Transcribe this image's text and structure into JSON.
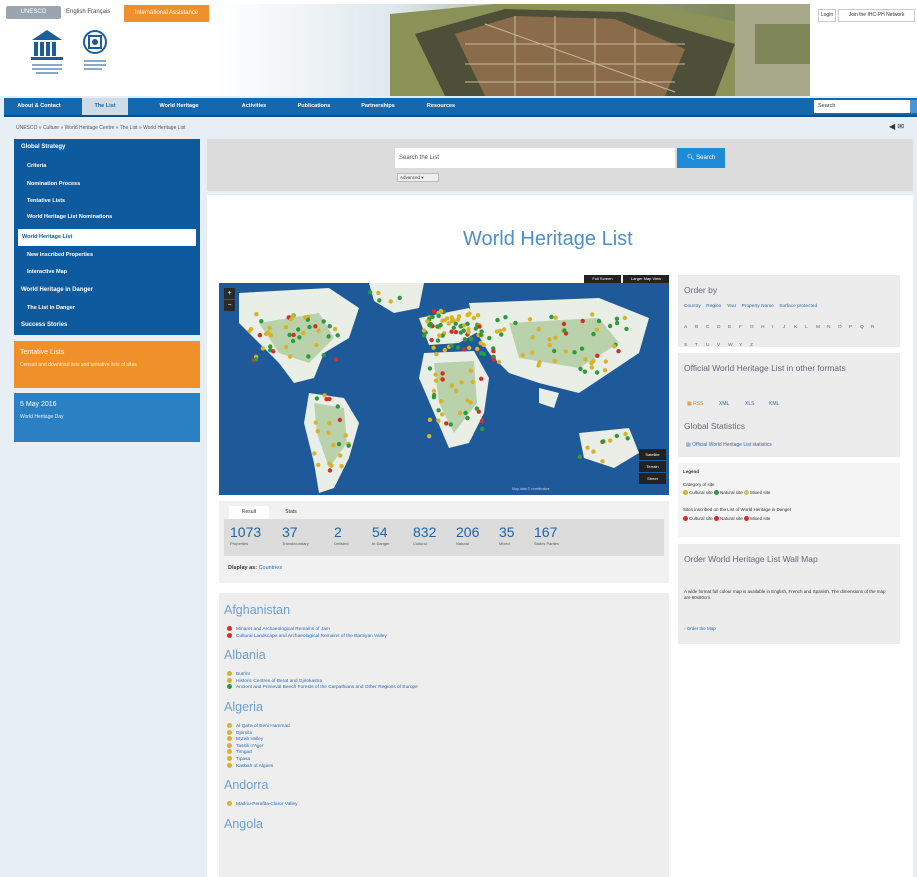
{
  "top": {
    "lang_pill": "UNESCO",
    "lang_links": "English Français",
    "orange_button": "International Assistance",
    "login": "Login",
    "join": "Join the IHC-PH Network"
  },
  "nav": {
    "items": [
      "About & Contact",
      "The List",
      "World Heritage",
      "Activities",
      "Publications",
      "Partnerships",
      "Resources"
    ],
    "search_value": "Search"
  },
  "breadcrumb": "UNESCO » Culture » World Heritage Centre » The List » World Heritage List",
  "sidebar": {
    "items": [
      "Global Strategy",
      "Criteria",
      "Nomination Process",
      "Tentative Lists",
      "World Heritage List Nominations",
      "World Heritage List",
      "New Inscribed Properties",
      "Interactive Map",
      "World Heritage in Danger",
      "The List in Danger",
      "Success Stories"
    ]
  },
  "promos": {
    "orange_title": "Tentative Lists",
    "orange_sub": "Consult and download lists and tentative lists of sites",
    "blue_title": "5 May 2016",
    "blue_sub": "World Heritage Day"
  },
  "search": {
    "placeholder": "Search the List",
    "button": "Search",
    "advanced": "Advanced"
  },
  "page_title": "World Heritage List",
  "map": {
    "btn_full": "Full Screen",
    "btn_large": "Larger Map View",
    "zoom_in": "+",
    "zoom_out": "−",
    "controls": [
      "Satellite",
      "Terrain",
      "Street"
    ],
    "attribution": "Map data © contributors"
  },
  "stats": {
    "tabs": [
      "Result",
      "Stats"
    ],
    "items": [
      {
        "num": "1073",
        "label": "Properties"
      },
      {
        "num": "37",
        "label": "Transboundary"
      },
      {
        "num": "2",
        "label": "Delisted"
      },
      {
        "num": "54",
        "label": "In Danger"
      },
      {
        "num": "832",
        "label": "Cultural"
      },
      {
        "num": "206",
        "label": "Natural"
      },
      {
        "num": "35",
        "label": "Mixed"
      },
      {
        "num": "167",
        "label": "States Parties"
      }
    ],
    "display": "Display as:",
    "display_value": "Countries"
  },
  "countries": [
    {
      "name": "Afghanistan",
      "sites": [
        {
          "t": "Minaret and Archaeological Remains of Jam",
          "c": "#d0322a"
        },
        {
          "t": "Cultural Landscape and Archaeological Remains of the Bamiyan Valley",
          "c": "#d0322a"
        }
      ]
    },
    {
      "name": "Albania",
      "sites": [
        {
          "t": "Butrint",
          "c": "#d7b22c"
        },
        {
          "t": "Historic Centres of Berat and Gjirokastra",
          "c": "#d7b22c"
        },
        {
          "t": "Ancient and Primeval Beech Forests of the Carpathians and Other Regions of Europe",
          "c": "#2f9a3c"
        }
      ]
    },
    {
      "name": "Algeria",
      "sites": [
        {
          "t": "Al Qal'a of Beni Hammad",
          "c": "#d7b22c"
        },
        {
          "t": "Djémila",
          "c": "#d7b22c"
        },
        {
          "t": "M'Zab Valley",
          "c": "#d7b22c"
        },
        {
          "t": "Tassili n'Ajjer",
          "c": "#d7b22c"
        },
        {
          "t": "Timgad",
          "c": "#d7b22c"
        },
        {
          "t": "Tipasa",
          "c": "#d7b22c"
        },
        {
          "t": "Kasbah of Algiers",
          "c": "#d7b22c"
        }
      ]
    },
    {
      "name": "Andorra",
      "sites": [
        {
          "t": "Madriu-Perafita-Claror Valley",
          "c": "#d7b22c"
        }
      ]
    },
    {
      "name": "Angola",
      "sites": []
    }
  ],
  "right": {
    "order_title": "Order by",
    "sort": [
      "Country",
      "Region",
      "Year",
      "Property Name",
      "Surface protected"
    ],
    "letters": [
      "A",
      "B",
      "C",
      "D",
      "E",
      "F",
      "G",
      "H",
      "I",
      "J",
      "K",
      "L",
      "M",
      "N",
      "O",
      "P",
      "Q",
      "R",
      "S",
      "T",
      "U",
      "V",
      "W",
      "Y",
      "Z"
    ],
    "official_title": "Official World Heritage List in other formats",
    "formats": [
      "RSS",
      "XML",
      "XLS",
      "KML"
    ],
    "global_title": "Global Statistics",
    "global_link": "Official World Heritage List statistics",
    "legend_title": "Legend",
    "legend_cat": "Category of site",
    "legend_row1": [
      "Cultural site",
      "Natural site",
      "Mixed site"
    ],
    "legend_danger": "Sites inscribed on the List of World Heritage in Danger",
    "legend_row2": [
      "Cultural site",
      "Natural site",
      "Mixed site"
    ],
    "order_map_title": "Order World Heritage List Wall Map",
    "order_map_text": "A wide format full colour map is available in English, French and Spanish. The dimensions of the map are 60x80cm.",
    "order_map_link": "Order the Map"
  },
  "colors": {
    "cultural": "#d7b22c",
    "natural": "#2f9a3c",
    "danger": "#d0322a",
    "brand": "#1668ad",
    "accent": "#f0902a"
  }
}
